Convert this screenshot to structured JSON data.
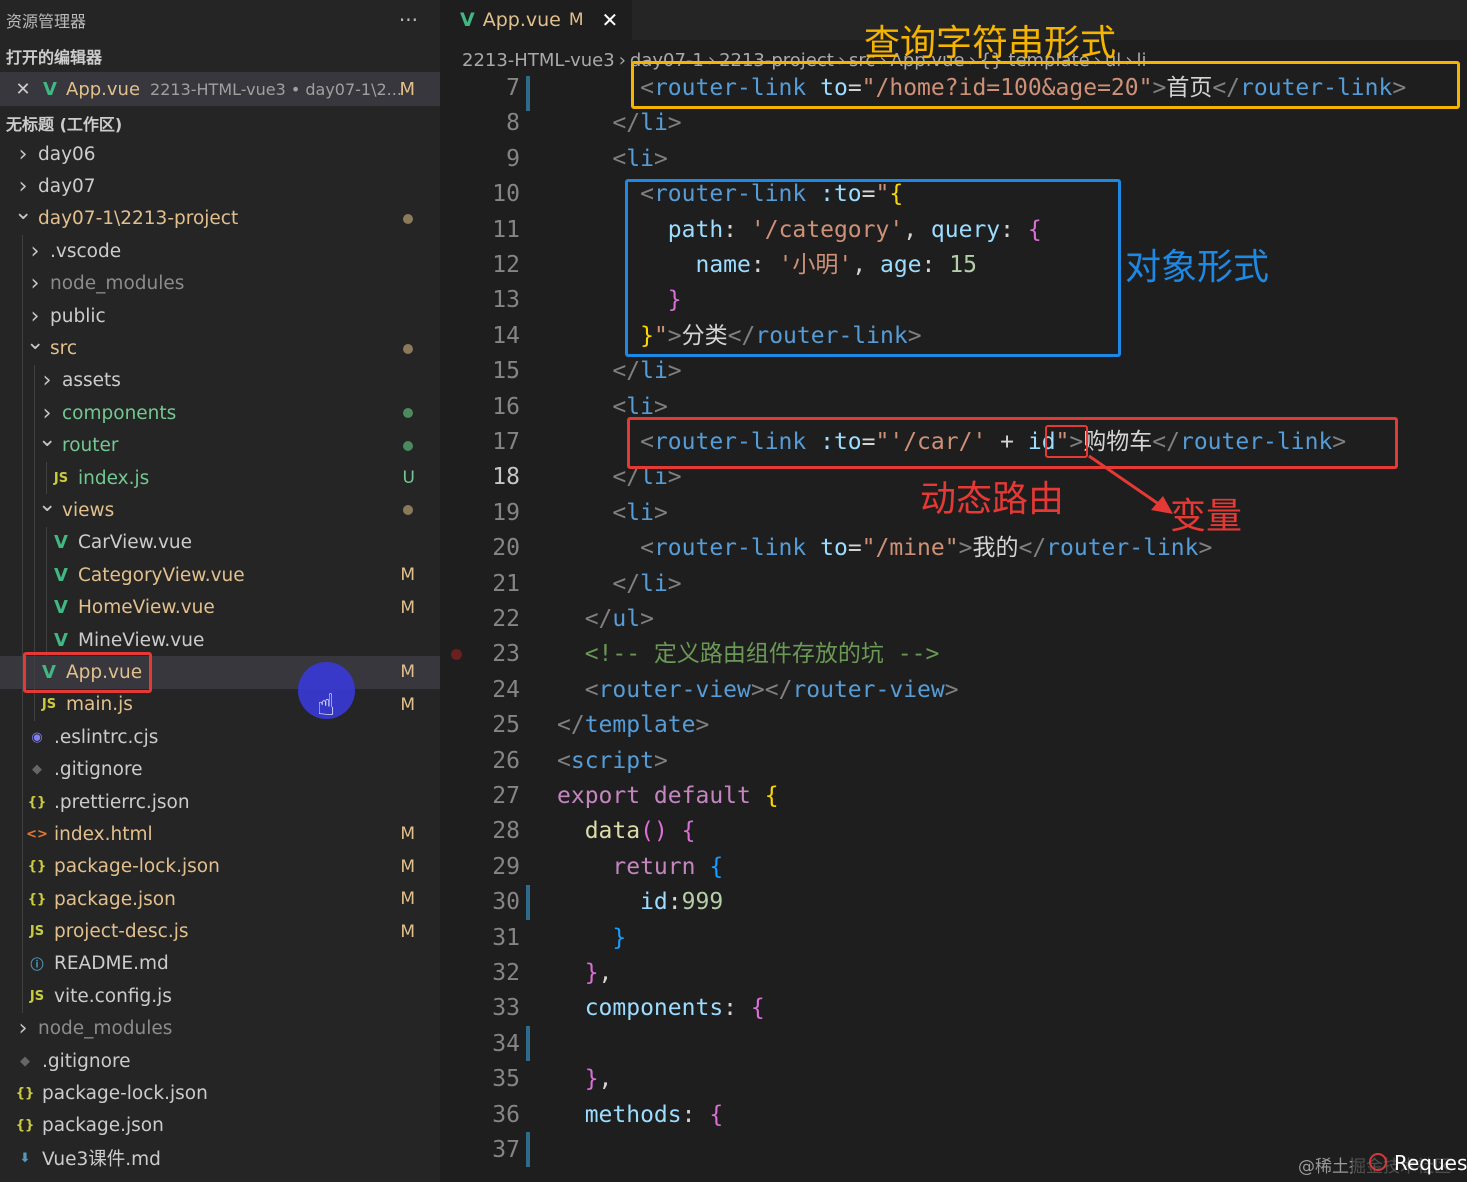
{
  "explorer": {
    "title": "资源管理器",
    "more": "···",
    "open_editors_label": "打开的编辑器",
    "open_editor": {
      "close": "✕",
      "name": "App.vue",
      "path": "2213-HTML-vue3 • day07-1\\2...",
      "badge": "M"
    },
    "workspace_label": "无标题 (工作区)",
    "tree": [
      {
        "label": "day06",
        "indent": 0,
        "kind": "folder-closed",
        "icon": "chevron-right-icon",
        "color": "#cccccc",
        "badge": "",
        "dot": false
      },
      {
        "label": "day07",
        "indent": 0,
        "kind": "folder-closed",
        "icon": "chevron-right-icon",
        "color": "#cccccc",
        "badge": "",
        "dot": false
      },
      {
        "label": "day07-1\\2213-project",
        "indent": 0,
        "kind": "folder-open",
        "icon": "chevron-down-icon",
        "color": "#e2c08d",
        "badge": "",
        "dot": true
      },
      {
        "label": ".vscode",
        "indent": 1,
        "kind": "folder-closed",
        "icon": "chevron-right-icon",
        "color": "#cccccc",
        "badge": "",
        "dot": false
      },
      {
        "label": "node_modules",
        "indent": 1,
        "kind": "folder-closed",
        "icon": "chevron-right-icon",
        "color": "#8c8c8c",
        "badge": "",
        "dot": false
      },
      {
        "label": "public",
        "indent": 1,
        "kind": "folder-closed",
        "icon": "chevron-right-icon",
        "color": "#cccccc",
        "badge": "",
        "dot": false
      },
      {
        "label": "src",
        "indent": 1,
        "kind": "folder-open",
        "icon": "chevron-down-icon",
        "color": "#e2c08d",
        "badge": "",
        "dot": true
      },
      {
        "label": "assets",
        "indent": 2,
        "kind": "folder-closed",
        "icon": "chevron-right-icon",
        "color": "#cccccc",
        "badge": "",
        "dot": false
      },
      {
        "label": "components",
        "indent": 2,
        "kind": "folder-closed",
        "icon": "chevron-right-icon",
        "color": "#73c991",
        "badge": "",
        "dot": true
      },
      {
        "label": "router",
        "indent": 2,
        "kind": "folder-open",
        "icon": "chevron-down-icon",
        "color": "#73c991",
        "badge": "",
        "dot": true
      },
      {
        "label": "index.js",
        "indent": 3,
        "kind": "js",
        "icon": "javascript-file-icon",
        "color": "#73c991",
        "badge": "U",
        "dot": false
      },
      {
        "label": "views",
        "indent": 2,
        "kind": "folder-open",
        "icon": "chevron-down-icon",
        "color": "#e2c08d",
        "badge": "",
        "dot": true
      },
      {
        "label": "CarView.vue",
        "indent": 3,
        "kind": "vue",
        "icon": "vue-file-icon",
        "color": "#cccccc",
        "badge": "",
        "dot": false
      },
      {
        "label": "CategoryView.vue",
        "indent": 3,
        "kind": "vue",
        "icon": "vue-file-icon",
        "color": "#e2c08d",
        "badge": "M",
        "dot": false
      },
      {
        "label": "HomeView.vue",
        "indent": 3,
        "kind": "vue",
        "icon": "vue-file-icon",
        "color": "#e2c08d",
        "badge": "M",
        "dot": false
      },
      {
        "label": "MineView.vue",
        "indent": 3,
        "kind": "vue",
        "icon": "vue-file-icon",
        "color": "#cccccc",
        "badge": "",
        "dot": false
      },
      {
        "label": "App.vue",
        "indent": 2,
        "kind": "vue",
        "icon": "vue-file-icon",
        "color": "#e2c08d",
        "badge": "M",
        "dot": false,
        "selected": true
      },
      {
        "label": "main.js",
        "indent": 2,
        "kind": "js",
        "icon": "javascript-file-icon",
        "color": "#e2c08d",
        "badge": "M",
        "dot": false
      },
      {
        "label": ".eslintrc.cjs",
        "indent": 1,
        "kind": "eslint",
        "icon": "eslint-file-icon",
        "color": "#cccccc",
        "badge": "",
        "dot": false
      },
      {
        "label": ".gitignore",
        "indent": 1,
        "kind": "git",
        "icon": "git-file-icon",
        "color": "#cccccc",
        "badge": "",
        "dot": false
      },
      {
        "label": ".prettierrc.json",
        "indent": 1,
        "kind": "json",
        "icon": "json-file-icon",
        "color": "#cccccc",
        "badge": "",
        "dot": false
      },
      {
        "label": "index.html",
        "indent": 1,
        "kind": "html",
        "icon": "html-file-icon",
        "color": "#e2c08d",
        "badge": "M",
        "dot": false
      },
      {
        "label": "package-lock.json",
        "indent": 1,
        "kind": "json",
        "icon": "json-file-icon",
        "color": "#e2c08d",
        "badge": "M",
        "dot": false
      },
      {
        "label": "package.json",
        "indent": 1,
        "kind": "json",
        "icon": "json-file-icon",
        "color": "#e2c08d",
        "badge": "M",
        "dot": false
      },
      {
        "label": "project-desc.js",
        "indent": 1,
        "kind": "js",
        "icon": "javascript-file-icon",
        "color": "#e2c08d",
        "badge": "M",
        "dot": false
      },
      {
        "label": "README.md",
        "indent": 1,
        "kind": "info",
        "icon": "info-file-icon",
        "color": "#cccccc",
        "badge": "",
        "dot": false
      },
      {
        "label": "vite.config.js",
        "indent": 1,
        "kind": "js",
        "icon": "javascript-file-icon",
        "color": "#cccccc",
        "badge": "",
        "dot": false
      },
      {
        "label": "node_modules",
        "indent": 0,
        "kind": "folder-closed",
        "icon": "chevron-right-icon",
        "color": "#8c8c8c",
        "badge": "",
        "dot": false
      },
      {
        "label": ".gitignore",
        "indent": 0,
        "kind": "git",
        "icon": "git-file-icon",
        "color": "#cccccc",
        "badge": "",
        "dot": false
      },
      {
        "label": "package-lock.json",
        "indent": 0,
        "kind": "json",
        "icon": "json-file-icon",
        "color": "#cccccc",
        "badge": "",
        "dot": false
      },
      {
        "label": "package.json",
        "indent": 0,
        "kind": "json",
        "icon": "json-file-icon",
        "color": "#cccccc",
        "badge": "",
        "dot": false
      },
      {
        "label": "Vue3课件.md",
        "indent": 0,
        "kind": "md",
        "icon": "markdown-file-icon",
        "color": "#cccccc",
        "badge": "",
        "dot": false
      }
    ]
  },
  "tab": {
    "name": "App.vue",
    "badge": "M",
    "close": "✕"
  },
  "breadcrumb": [
    "2213-HTML-vue3",
    "day07-1",
    "2213-project",
    "src",
    "App.vue",
    "{} template",
    "ul",
    "li"
  ],
  "code_lines": [
    {
      "n": "7",
      "tokens": [
        [
          "tg",
          "      <"
        ],
        [
          "tn",
          "router-link"
        ],
        [
          "at",
          " to"
        ],
        [
          "tx",
          "="
        ],
        [
          "st",
          "\"/home?id=100&age=20\""
        ],
        [
          "tg",
          ">"
        ],
        [
          "tx",
          "首页"
        ],
        [
          "tg",
          "</"
        ],
        [
          "tn",
          "router-link"
        ],
        [
          "tg",
          ">"
        ]
      ]
    },
    {
      "n": "8",
      "tokens": [
        [
          "tg",
          "    </"
        ],
        [
          "tn",
          "li"
        ],
        [
          "tg",
          ">"
        ]
      ]
    },
    {
      "n": "9",
      "tokens": [
        [
          "tg",
          "    <"
        ],
        [
          "tn",
          "li"
        ],
        [
          "tg",
          ">"
        ]
      ]
    },
    {
      "n": "10",
      "tokens": [
        [
          "tg",
          "      <"
        ],
        [
          "tn",
          "router-link"
        ],
        [
          "at",
          " :to"
        ],
        [
          "tx",
          "="
        ],
        [
          "st",
          "\""
        ],
        [
          "br",
          "{"
        ]
      ]
    },
    {
      "n": "11",
      "tokens": [
        [
          "at",
          "        path"
        ],
        [
          "tx",
          ": "
        ],
        [
          "st",
          "'/category'"
        ],
        [
          "tx",
          ", "
        ],
        [
          "at",
          "query"
        ],
        [
          "tx",
          ": "
        ],
        [
          "br2",
          "{"
        ]
      ]
    },
    {
      "n": "12",
      "tokens": [
        [
          "at",
          "          name"
        ],
        [
          "tx",
          ": "
        ],
        [
          "st",
          "'小明'"
        ],
        [
          "tx",
          ", "
        ],
        [
          "at",
          "age"
        ],
        [
          "tx",
          ": "
        ],
        [
          "nm",
          "15"
        ]
      ]
    },
    {
      "n": "13",
      "tokens": [
        [
          "br2",
          "        }"
        ]
      ]
    },
    {
      "n": "14",
      "tokens": [
        [
          "br",
          "      }"
        ],
        [
          "st",
          "\""
        ],
        [
          "tg",
          ">"
        ],
        [
          "tx",
          "分类"
        ],
        [
          "tg",
          "</"
        ],
        [
          "tn",
          "router-link"
        ],
        [
          "tg",
          ">"
        ]
      ]
    },
    {
      "n": "15",
      "tokens": [
        [
          "tg",
          "    </"
        ],
        [
          "tn",
          "li"
        ],
        [
          "tg",
          ">"
        ]
      ]
    },
    {
      "n": "16",
      "tokens": [
        [
          "tg",
          "    <"
        ],
        [
          "tn",
          "li"
        ],
        [
          "tg",
          ">"
        ]
      ]
    },
    {
      "n": "17",
      "tokens": [
        [
          "tg",
          "      <"
        ],
        [
          "tn",
          "router-link"
        ],
        [
          "at",
          " :to"
        ],
        [
          "tx",
          "="
        ],
        [
          "st",
          "\"'/car/'"
        ],
        [
          "tx",
          " + "
        ],
        [
          "at",
          "id"
        ],
        [
          "st",
          "\""
        ],
        [
          "tg",
          ">"
        ],
        [
          "tx",
          "购物车"
        ],
        [
          "tg",
          "</"
        ],
        [
          "tn",
          "router-link"
        ],
        [
          "tg",
          ">"
        ]
      ]
    },
    {
      "n": "18",
      "tokens": [
        [
          "tg",
          "    </"
        ],
        [
          "tn",
          "li"
        ],
        [
          "tg",
          ">"
        ]
      ],
      "active": true
    },
    {
      "n": "19",
      "tokens": [
        [
          "tg",
          "    <"
        ],
        [
          "tn",
          "li"
        ],
        [
          "tg",
          ">"
        ]
      ]
    },
    {
      "n": "20",
      "tokens": [
        [
          "tg",
          "      <"
        ],
        [
          "tn",
          "router-link"
        ],
        [
          "at",
          " to"
        ],
        [
          "tx",
          "="
        ],
        [
          "st",
          "\"/mine\""
        ],
        [
          "tg",
          ">"
        ],
        [
          "tx",
          "我的"
        ],
        [
          "tg",
          "</"
        ],
        [
          "tn",
          "router-link"
        ],
        [
          "tg",
          ">"
        ]
      ]
    },
    {
      "n": "21",
      "tokens": [
        [
          "tg",
          "    </"
        ],
        [
          "tn",
          "li"
        ],
        [
          "tg",
          ">"
        ]
      ]
    },
    {
      "n": "22",
      "tokens": [
        [
          "tg",
          "  </"
        ],
        [
          "tn",
          "ul"
        ],
        [
          "tg",
          ">"
        ]
      ]
    },
    {
      "n": "23",
      "tokens": [
        [
          "cm",
          "  <!-- 定义路由组件存放的坑 -->"
        ]
      ]
    },
    {
      "n": "24",
      "tokens": [
        [
          "tg",
          "  <"
        ],
        [
          "tn",
          "router-view"
        ],
        [
          "tg",
          "></"
        ],
        [
          "tn",
          "router-view"
        ],
        [
          "tg",
          ">"
        ]
      ]
    },
    {
      "n": "25",
      "tokens": [
        [
          "tg",
          "</"
        ],
        [
          "tn",
          "template"
        ],
        [
          "tg",
          ">"
        ]
      ]
    },
    {
      "n": "26",
      "tokens": [
        [
          "tg",
          "<"
        ],
        [
          "tn",
          "script"
        ],
        [
          "tg",
          ">"
        ]
      ]
    },
    {
      "n": "27",
      "tokens": [
        [
          "kw",
          "export default "
        ],
        [
          "br",
          "{"
        ]
      ]
    },
    {
      "n": "28",
      "tokens": [
        [
          "fn",
          "  data"
        ],
        [
          "br2",
          "()"
        ],
        [
          "tx",
          " "
        ],
        [
          "br2",
          "{"
        ]
      ]
    },
    {
      "n": "29",
      "tokens": [
        [
          "kw",
          "    return "
        ],
        [
          "br3",
          "{"
        ]
      ]
    },
    {
      "n": "30",
      "tokens": [
        [
          "at",
          "      id"
        ],
        [
          "tx",
          ":"
        ],
        [
          "nm",
          "999"
        ]
      ]
    },
    {
      "n": "31",
      "tokens": [
        [
          "br3",
          "    }"
        ]
      ]
    },
    {
      "n": "32",
      "tokens": [
        [
          "br2",
          "  }"
        ],
        [
          "tx",
          ","
        ]
      ]
    },
    {
      "n": "33",
      "tokens": [
        [
          "at",
          "  components"
        ],
        [
          "tx",
          ": "
        ],
        [
          "br2",
          "{"
        ]
      ]
    },
    {
      "n": "34",
      "tokens": [
        [
          "tx",
          ""
        ]
      ]
    },
    {
      "n": "35",
      "tokens": [
        [
          "br2",
          "  }"
        ],
        [
          "tx",
          ","
        ]
      ]
    },
    {
      "n": "36",
      "tokens": [
        [
          "at",
          "  methods"
        ],
        [
          "tx",
          ": "
        ],
        [
          "br2",
          "{"
        ]
      ]
    },
    {
      "n": "37",
      "tokens": [
        [
          "tx",
          ""
        ]
      ]
    }
  ],
  "annotations": {
    "query_string": "查询字符串形式",
    "object_form": "对象形式",
    "dynamic_route": "动态路由",
    "variable": "变量"
  },
  "colors": {
    "yellow_box": "#f5b400",
    "blue_box": "#1e88e5",
    "red_box": "#e53935",
    "annotation_yellow": "#f5b400",
    "annotation_blue": "#1e88e5",
    "annotation_red": "#e53935"
  },
  "watermark": "@稀土掘金技术社区",
  "corner_label": "Request"
}
